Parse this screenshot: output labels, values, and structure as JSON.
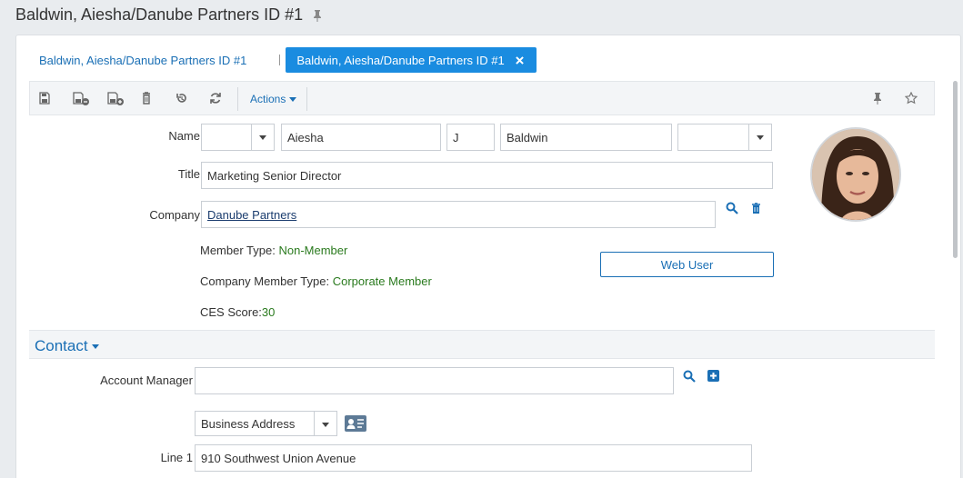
{
  "page": {
    "title": "Baldwin, Aiesha/Danube Partners ID #1"
  },
  "tabs": [
    {
      "label": "Baldwin, Aiesha/Danube Partners ID #1"
    },
    {
      "label": "Baldwin, Aiesha/Danube Partners ID #1"
    }
  ],
  "toolbar": {
    "actions_label": "Actions"
  },
  "form": {
    "name_label": "Name",
    "prefix_value": "",
    "first_name": "Aiesha",
    "middle_initial": "J",
    "last_name": "Baldwin",
    "suffix_value": "",
    "title_label": "Title",
    "title_value": "Marketing Senior Director",
    "company_label": "Company",
    "company_value": "Danube Partners",
    "member_type_label": "Member Type: ",
    "member_type_value": "Non-Member",
    "company_member_type_label": "Company Member Type: ",
    "company_member_type_value": "Corporate Member",
    "ces_label": "CES Score:",
    "ces_value": "30",
    "web_user_label": "Web User"
  },
  "contact": {
    "section_title": "Contact",
    "account_manager_label": "Account Manager",
    "account_manager_value": "",
    "address_type": "Business Address",
    "line1_label": "Line 1",
    "line1_value": "910 Southwest Union Avenue"
  },
  "colors": {
    "accent": "#1a8ce0",
    "link": "#1a6fb5",
    "value_green": "#2a7a1e"
  }
}
